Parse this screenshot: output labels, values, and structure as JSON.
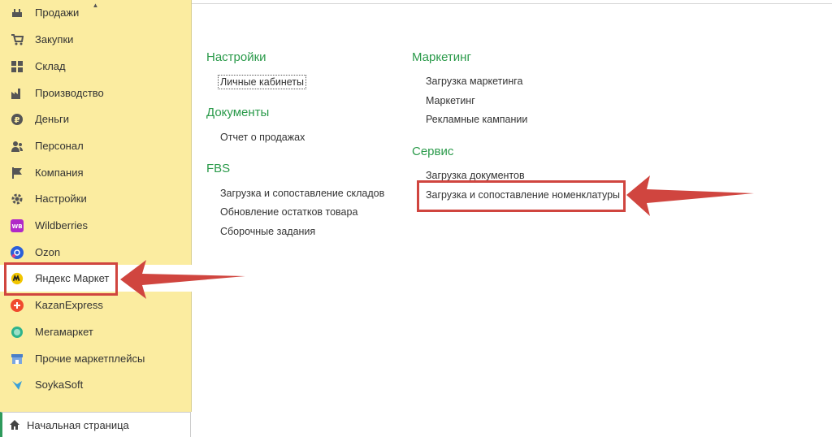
{
  "sidebar": {
    "items": [
      {
        "label": "Продажи",
        "icon": "sales-icon"
      },
      {
        "label": "Закупки",
        "icon": "cart-icon"
      },
      {
        "label": "Склад",
        "icon": "warehouse-icon"
      },
      {
        "label": "Производство",
        "icon": "factory-icon"
      },
      {
        "label": "Деньги",
        "icon": "ruble-icon"
      },
      {
        "label": "Персонал",
        "icon": "people-icon"
      },
      {
        "label": "Компания",
        "icon": "flag-icon"
      },
      {
        "label": "Настройки",
        "icon": "gear-icon"
      },
      {
        "label": "Wildberries",
        "icon": "wildberries-icon"
      },
      {
        "label": "Ozon",
        "icon": "ozon-icon"
      },
      {
        "label": "Яндекс Маркет",
        "icon": "yandex-market-icon"
      },
      {
        "label": "KazanExpress",
        "icon": "kazanexpress-icon"
      },
      {
        "label": "Мегамаркет",
        "icon": "megamarket-icon"
      },
      {
        "label": "Прочие маркетплейсы",
        "icon": "store-icon"
      },
      {
        "label": "SoykaSoft",
        "icon": "soykasoft-icon"
      }
    ],
    "home": {
      "label": "Начальная страница",
      "icon": "home-icon"
    }
  },
  "sections": {
    "settings": {
      "title": "Настройки",
      "links": [
        "Личные кабинеты"
      ]
    },
    "documents": {
      "title": "Документы",
      "links": [
        "Отчет о продажах"
      ]
    },
    "fbs": {
      "title": "FBS",
      "links": [
        "Загрузка и сопоставление складов",
        "Обновление остатков товара",
        "Сборочные задания"
      ]
    },
    "marketing": {
      "title": "Маркетинг",
      "links": [
        "Загрузка маркетинга",
        "Маркетинг",
        "Рекламные кампании"
      ]
    },
    "service": {
      "title": "Сервис",
      "links": [
        "Загрузка документов",
        "Загрузка и сопоставление номенклатуры"
      ]
    }
  },
  "colors": {
    "accent": "#2a9a4a",
    "sidebar_bg": "#fbeca0",
    "annotation": "#d0453f"
  }
}
